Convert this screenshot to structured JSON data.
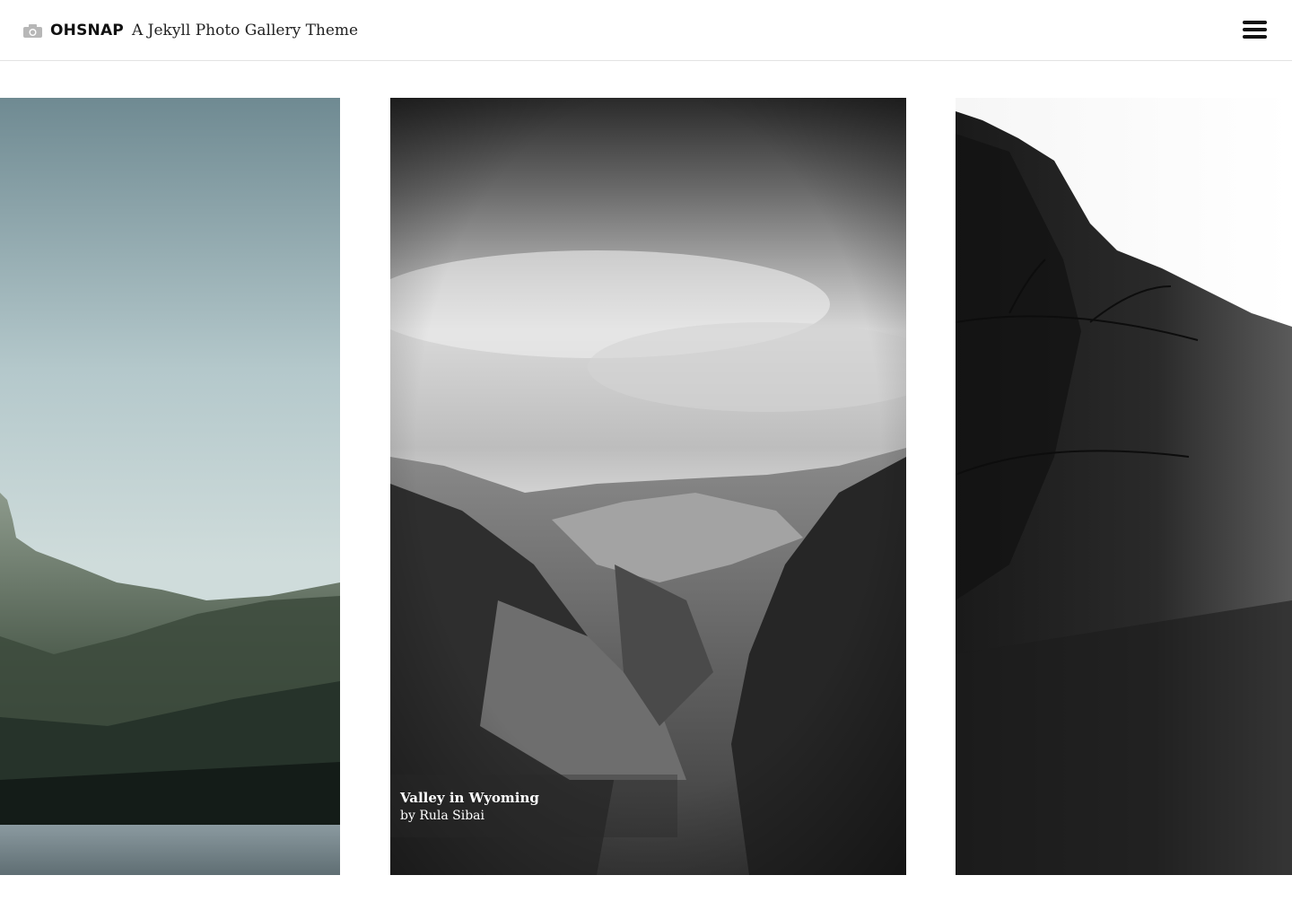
{
  "header": {
    "logo_icon": "camera-icon",
    "brand": "OHSNAP",
    "tagline": "A Jekyll Photo Gallery Theme",
    "menu_icon": "hamburger-menu-icon"
  },
  "gallery": {
    "photos": [
      {
        "name": "mountain-lake"
      },
      {
        "name": "valley",
        "caption": {
          "title": "Valley in Wyoming",
          "credit": "by Rula Sibai"
        }
      },
      {
        "name": "pine-ridge"
      }
    ]
  },
  "colors": {
    "header_border": "#e3e3e3",
    "text": "#111111",
    "background": "#ffffff"
  }
}
